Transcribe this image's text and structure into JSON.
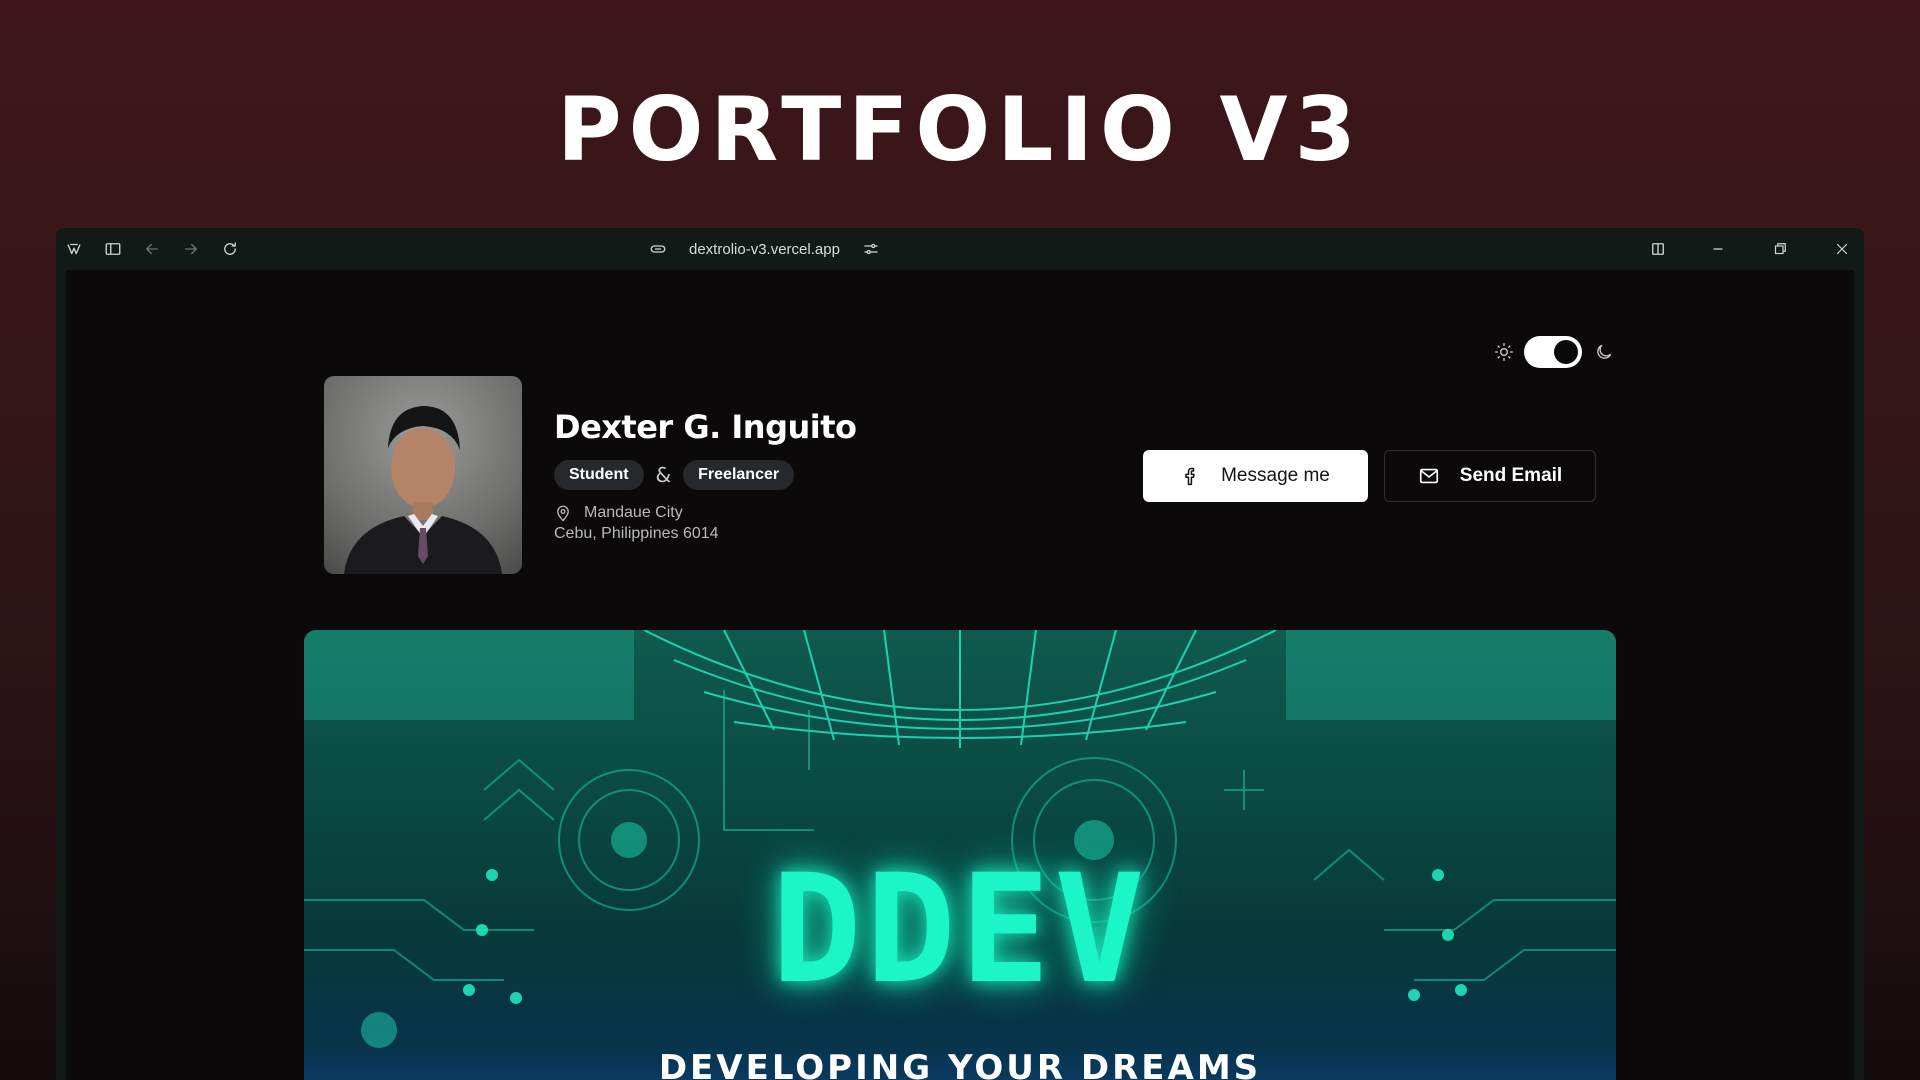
{
  "headline": "PORTFOLIO V3",
  "browser": {
    "url": "dextrolio-v3.vercel.app",
    "icons": [
      "app-logo-icon",
      "sidebar-icon",
      "back-arrow-icon",
      "forward-arrow-icon",
      "reload-icon",
      "link-icon",
      "site-settings-icon",
      "split-view-icon",
      "minimize-icon",
      "restore-icon",
      "close-icon"
    ]
  },
  "page": {
    "theme_toggle": {
      "mode": "dark",
      "icons": [
        "sun-icon",
        "moon-icon"
      ]
    },
    "profile": {
      "name": "Dexter G. Inguito",
      "tags": [
        "Student",
        "Freelancer"
      ],
      "tag_separator": "&",
      "location_line1": "Mandaue City",
      "location_line2": "Cebu, Philippines 6014"
    },
    "buttons": {
      "message": "Message me",
      "email": "Send Email"
    },
    "banner": {
      "logo": "DDEV",
      "tagline": "DEVELOPING YOUR DREAMS"
    }
  },
  "colors": {
    "background": "#3d171b",
    "browser_chrome": "#111a17",
    "viewport": "#0b090a",
    "banner_accent": "#1cf5c8"
  }
}
